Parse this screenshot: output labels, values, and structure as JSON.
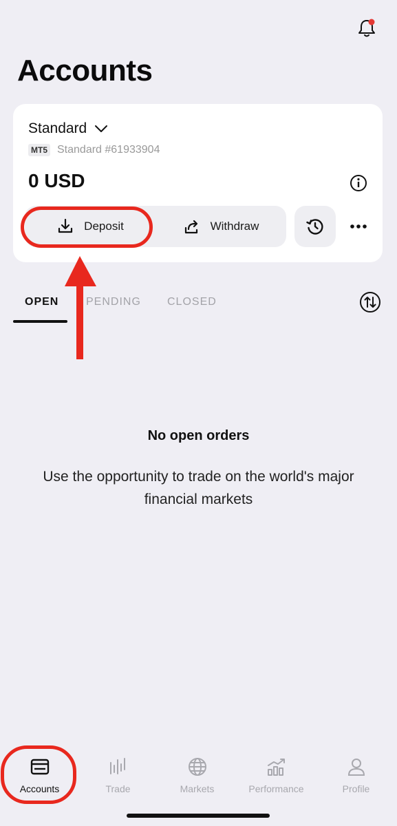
{
  "header": {
    "title": "Accounts",
    "notification_icon": "bell-icon",
    "notification_dot_color": "#e53935"
  },
  "account": {
    "name": "Standard",
    "platform": "MT5",
    "number": "Standard #61933904",
    "balance": "0 USD"
  },
  "actions": {
    "deposit_label": "Deposit",
    "withdraw_label": "Withdraw",
    "history_icon": "history-icon",
    "more_icon": "more-icon"
  },
  "tabs": [
    {
      "label": "OPEN",
      "active": true
    },
    {
      "label": "PENDING",
      "active": false
    },
    {
      "label": "CLOSED",
      "active": false
    }
  ],
  "empty_state": {
    "title": "No open orders",
    "description": "Use the opportunity to trade on the world's major financial markets"
  },
  "bottom_nav": [
    {
      "label": "Accounts",
      "icon": "card-icon",
      "active": true
    },
    {
      "label": "Trade",
      "icon": "candles-icon",
      "active": false
    },
    {
      "label": "Markets",
      "icon": "globe-icon",
      "active": false
    },
    {
      "label": "Performance",
      "icon": "chart-icon",
      "active": false
    },
    {
      "label": "Profile",
      "icon": "user-icon",
      "active": false
    }
  ],
  "colors": {
    "background": "#efeef4",
    "annotation": "#e8281e"
  }
}
